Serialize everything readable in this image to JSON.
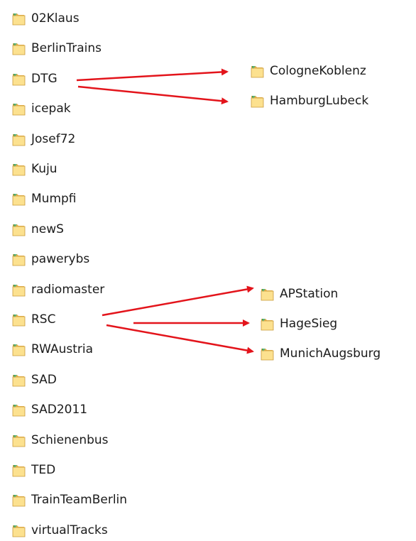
{
  "folders": [
    {
      "name": "02Klaus"
    },
    {
      "name": "BerlinTrains"
    },
    {
      "name": "DTG"
    },
    {
      "name": "icepak"
    },
    {
      "name": "Josef72"
    },
    {
      "name": "Kuju"
    },
    {
      "name": "Mumpfi"
    },
    {
      "name": "newS"
    },
    {
      "name": "pawerybs"
    },
    {
      "name": "radiomaster"
    },
    {
      "name": "RSC"
    },
    {
      "name": "RWAustria"
    },
    {
      "name": "SAD"
    },
    {
      "name": "SAD2011"
    },
    {
      "name": "Schienenbus"
    },
    {
      "name": "TED"
    },
    {
      "name": "TrainTeamBerlin"
    },
    {
      "name": "virtualTracks"
    }
  ],
  "dtg_children": [
    {
      "name": "CologneKoblenz"
    },
    {
      "name": "HamburgLubeck"
    }
  ],
  "rsc_children": [
    {
      "name": "APStation"
    },
    {
      "name": "HageSieg"
    },
    {
      "name": "MunichAugsburg"
    }
  ],
  "icon": "folder-icon",
  "colors": {
    "arrow": "#e3141b",
    "folder_back": "#e8b04b",
    "folder_front": "#fce18f",
    "folder_edge": "#c99a3a",
    "folder_tab_green": "#3f9a5a"
  }
}
